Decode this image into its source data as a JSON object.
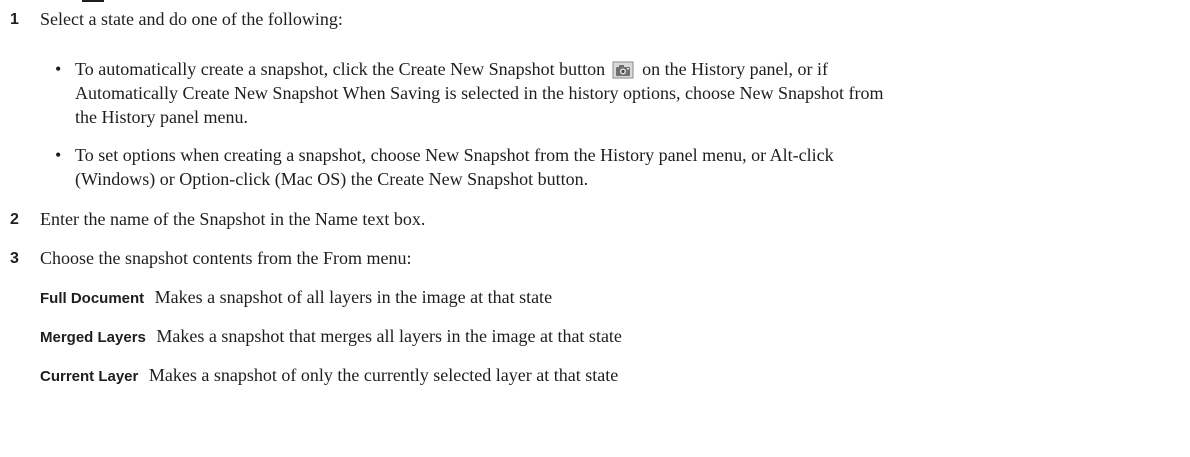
{
  "steps": [
    {
      "number": "1",
      "text": "Select a state and do one of the following:",
      "bullets": [
        {
          "line1_before_icon": "To automatically create a snapshot, click the Create New Snapshot button",
          "line1_after_icon": "on the History panel, or if",
          "line2": "Automatically Create New Snapshot When Saving is selected in the history options, choose New Snapshot from",
          "line3": "the History panel menu."
        },
        {
          "line1": "To set options when creating a snapshot, choose New Snapshot from the History panel menu, or Alt-click",
          "line2": "(Windows) or Option-click (Mac OS) the Create New Snapshot button."
        }
      ]
    },
    {
      "number": "2",
      "text": "Enter the name of the Snapshot in the Name text box."
    },
    {
      "number": "3",
      "text": "Choose the snapshot contents from the From menu:"
    }
  ],
  "definitions": [
    {
      "term": "Full Document",
      "desc": "Makes a snapshot of all layers in the image at that state"
    },
    {
      "term": "Merged Layers",
      "desc": "Makes a snapshot that merges all layers in the image at that state"
    },
    {
      "term": "Current Layer",
      "desc": "Makes a snapshot of only the currently selected layer at that state"
    }
  ],
  "bullet_glyph": "•",
  "icon": "camera-snapshot-icon"
}
